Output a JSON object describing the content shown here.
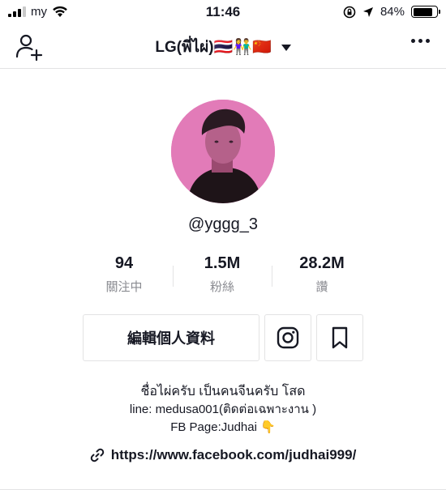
{
  "status_bar": {
    "carrier": "my",
    "time": "11:46",
    "battery": "84%",
    "battery_level": 0.84,
    "icons": [
      "signal-icon",
      "wifi-icon",
      "screen-lock-icon",
      "location-arrow-icon",
      "battery-icon"
    ]
  },
  "nav": {
    "title": "LG(พี่ไผ่)🇹🇭👫🇨🇳",
    "add_user_icon": "add-user-icon",
    "more_icon": "more-options-icon",
    "caret_icon": "caret-down-icon"
  },
  "profile": {
    "username": "@yggg_3",
    "avatar_tint": "#e27bb8"
  },
  "stats": [
    {
      "value": "94",
      "label": "關注中"
    },
    {
      "value": "1.5M",
      "label": "粉絲"
    },
    {
      "value": "28.2M",
      "label": "讚"
    }
  ],
  "actions": {
    "edit_label": "編輯個人資料",
    "instagram_icon": "instagram-icon",
    "bookmark_icon": "bookmark-icon"
  },
  "bio": {
    "line1": "ชื่อไผ่ครับ เป็นคนจีนครับ โสด",
    "line2": "line: medusa001(ติดต่อเฉพาะงาน )",
    "line3": "FB Page:Judhai 👇"
  },
  "link": {
    "url": "https://www.facebook.com/judhai999/",
    "icon": "link-icon"
  },
  "colors": {
    "text": "#161823",
    "muted": "#8a8b91",
    "border": "#e3e3e4"
  }
}
